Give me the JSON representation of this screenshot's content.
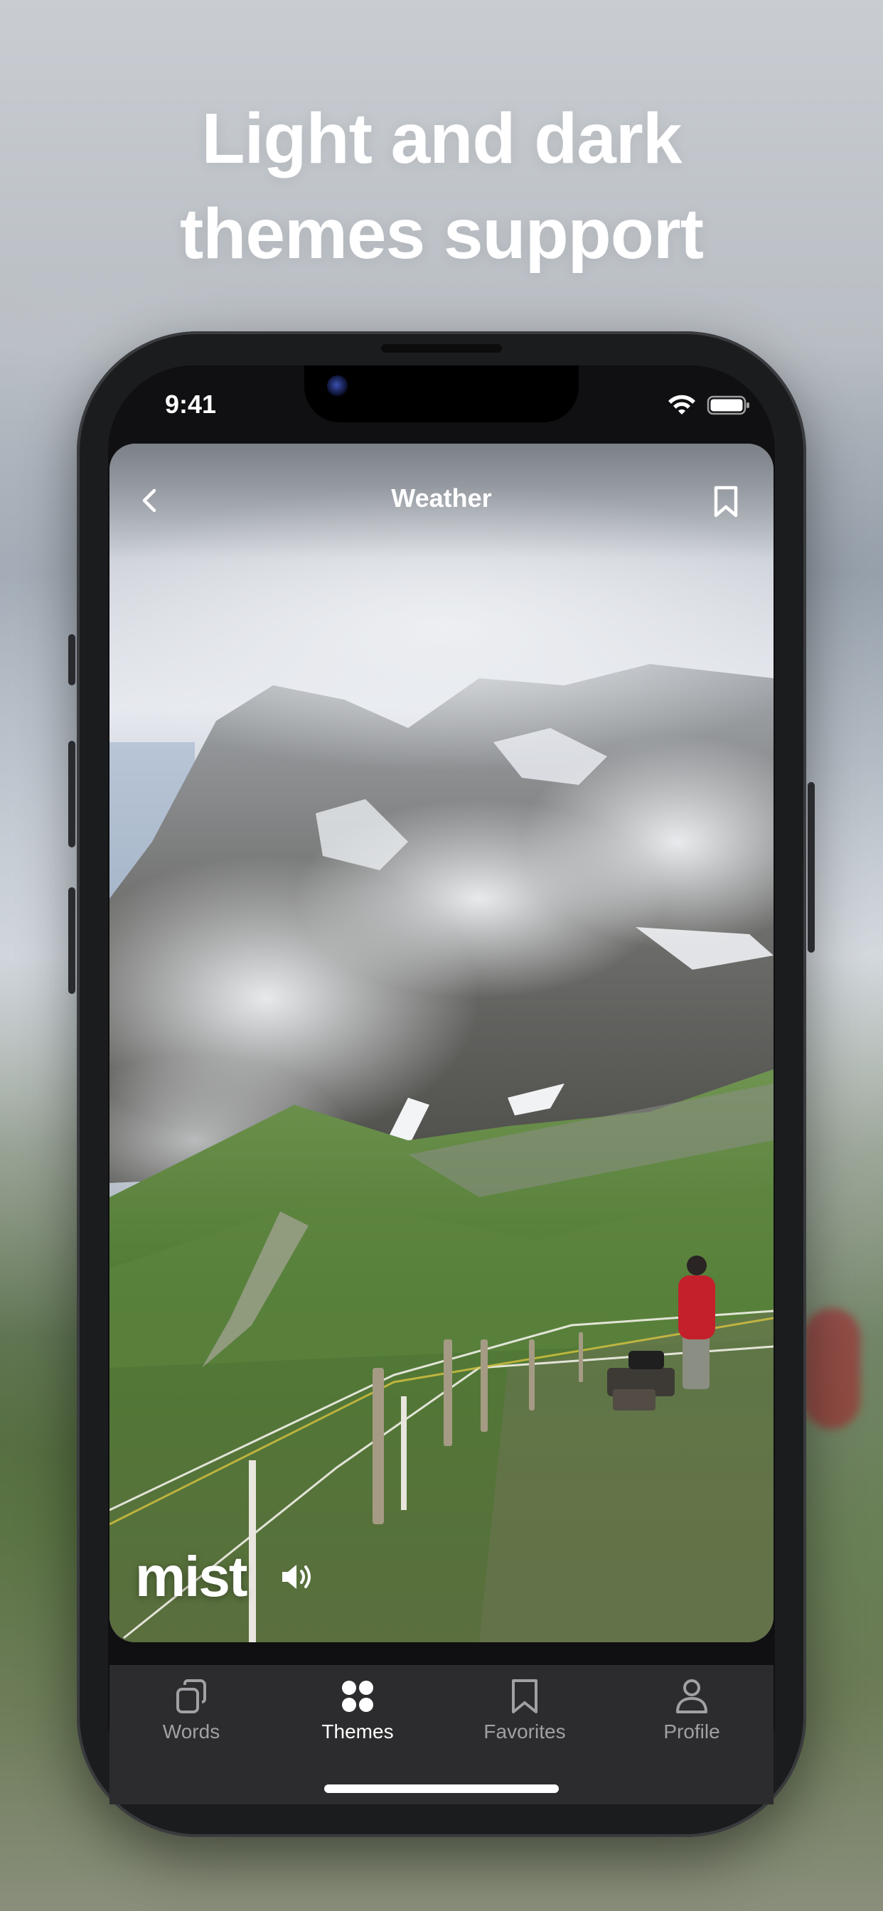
{
  "headline": {
    "line1": "Light and dark",
    "line2": "themes support"
  },
  "status_bar": {
    "time": "9:41",
    "icons": [
      "wifi-icon",
      "battery-icon"
    ]
  },
  "nav": {
    "title": "Weather",
    "back_icon": "chevron-left-icon",
    "bookmark_icon": "bookmark-icon"
  },
  "card": {
    "word": "mist",
    "sound_icon": "speaker-icon"
  },
  "tabs": [
    {
      "label": "Words",
      "icon": "cards-icon",
      "active": false
    },
    {
      "label": "Themes",
      "icon": "grid-dots-icon",
      "active": true
    },
    {
      "label": "Favorites",
      "icon": "bookmark-icon",
      "active": false
    },
    {
      "label": "Profile",
      "icon": "person-icon",
      "active": false
    }
  ],
  "colors": {
    "tab_active": "#ffffff",
    "tab_inactive": "#a0a0a5",
    "tabbar_bg": "#2c2c2e"
  }
}
